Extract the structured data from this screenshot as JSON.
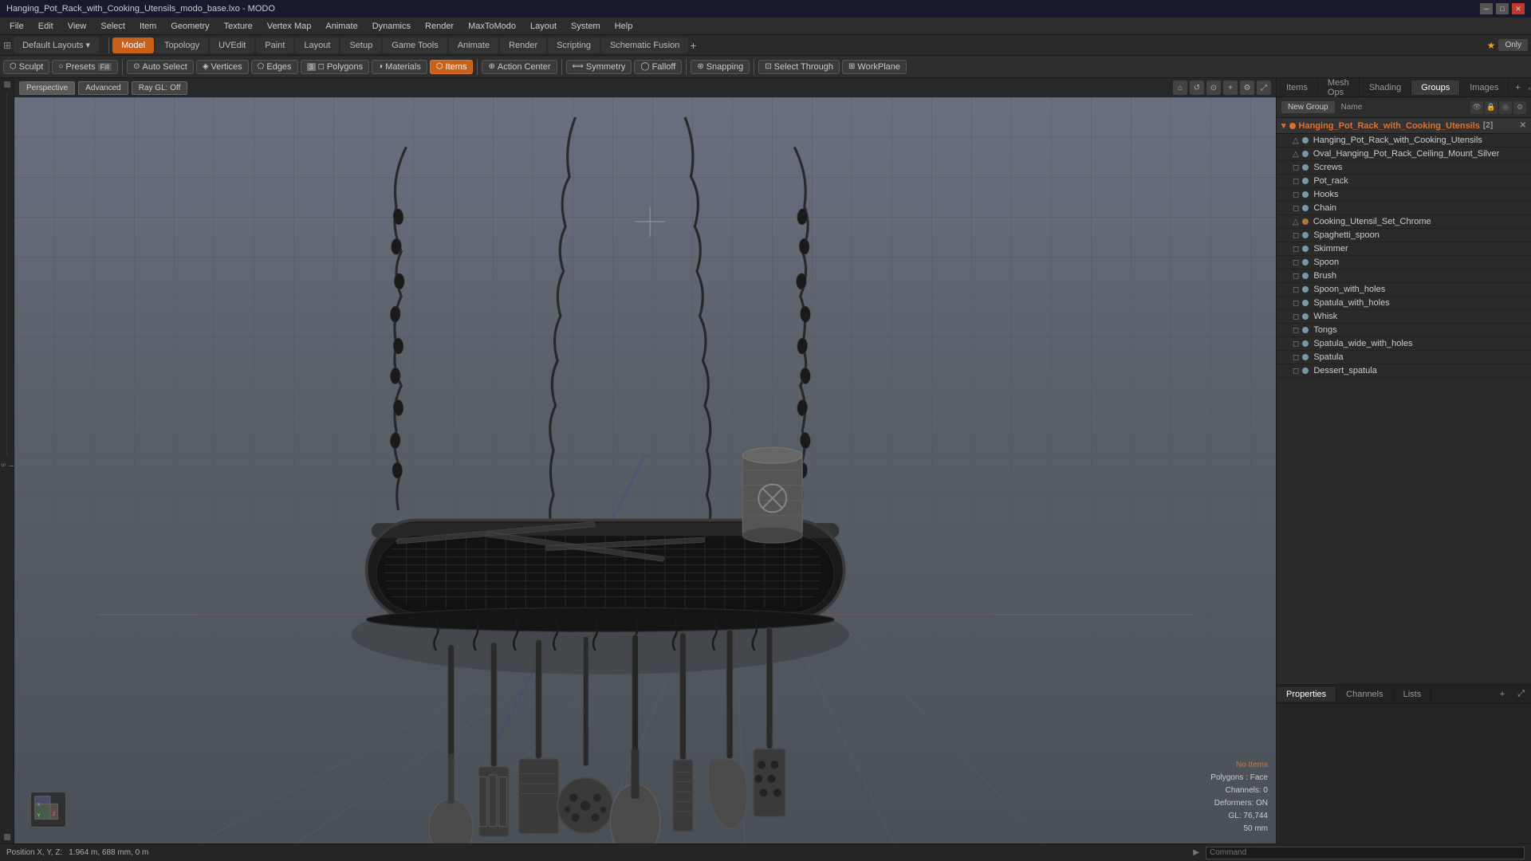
{
  "window": {
    "title": "Hanging_Pot_Rack_with_Cooking_Utensils_modo_base.lxo - MODO"
  },
  "menu": {
    "items": [
      "File",
      "Edit",
      "View",
      "Select",
      "Item",
      "Geometry",
      "Texture",
      "Vertex Map",
      "Animate",
      "Dynamics",
      "Render",
      "MaxToModo",
      "Layout",
      "System",
      "Help"
    ]
  },
  "toolbar_row1": {
    "tabs": [
      "Model",
      "Topology",
      "UVEdit",
      "Paint",
      "Layout",
      "Setup",
      "Game Tools",
      "Animate",
      "Render",
      "Scripting",
      "Schematic Fusion"
    ],
    "active_tab": "Model",
    "star_label": "★",
    "only_label": "Only",
    "plus_label": "+"
  },
  "toolbar_row2": {
    "sculpt_label": "Sculpt",
    "presets_label": "Presets",
    "fill_label": "Fill",
    "auto_select_label": "Auto Select",
    "vertices_label": "Vertices",
    "edges_label": "Edges",
    "polygons_count": "3",
    "polygons_label": "Polygons",
    "materials_label": "Materials",
    "items_label": "Items",
    "action_center_label": "Action Center",
    "symmetry_label": "Symmetry",
    "falloff_label": "Falloff",
    "snapping_label": "Snapping",
    "select_through_label": "Select Through",
    "workplane_label": "WorkPlane"
  },
  "viewport": {
    "mode_label": "Perspective",
    "advanced_label": "Advanced",
    "render_label": "Ray GL: Off",
    "stats": {
      "no_items": "No Items",
      "polygons_label": "Polygons : Face",
      "channels": "Channels: 0",
      "deformers": "Deformers: ON",
      "gl": "GL: 76,744",
      "size": "50 mm"
    }
  },
  "right_panel": {
    "tabs": [
      "Items",
      "Mesh Ops",
      "Shading",
      "Groups",
      "Images"
    ],
    "active_tab": "Groups",
    "plus_label": "+"
  },
  "items_panel": {
    "new_group_label": "New Group",
    "name_col": "Name",
    "group_name": "Hanging_Pot_Rack_with_Cooking_Utensils",
    "group_count": "2",
    "items": [
      {
        "name": "Hanging_Pot_Rack_with_Cooking_Utensils",
        "indent": 1,
        "type": "mesh"
      },
      {
        "name": "Oval_Hanging_Pot_Rack_Ceiling_Mount_Silver",
        "indent": 1,
        "type": "mesh"
      },
      {
        "name": "Screws",
        "indent": 1,
        "type": "mesh"
      },
      {
        "name": "Pot_rack",
        "indent": 1,
        "type": "mesh"
      },
      {
        "name": "Hooks",
        "indent": 1,
        "type": "mesh"
      },
      {
        "name": "Chain",
        "indent": 1,
        "type": "mesh"
      },
      {
        "name": "Cooking_Utensil_Set_Chrome",
        "indent": 1,
        "type": "group"
      },
      {
        "name": "Spaghetti_spoon",
        "indent": 1,
        "type": "mesh"
      },
      {
        "name": "Skimmer",
        "indent": 1,
        "type": "mesh"
      },
      {
        "name": "Spoon",
        "indent": 1,
        "type": "mesh"
      },
      {
        "name": "Brush",
        "indent": 1,
        "type": "mesh"
      },
      {
        "name": "Spoon_with_holes",
        "indent": 1,
        "type": "mesh"
      },
      {
        "name": "Spatula_with_holes",
        "indent": 1,
        "type": "mesh"
      },
      {
        "name": "Whisk",
        "indent": 1,
        "type": "mesh"
      },
      {
        "name": "Tongs",
        "indent": 1,
        "type": "mesh"
      },
      {
        "name": "Spatula_wide_with_holes",
        "indent": 1,
        "type": "mesh"
      },
      {
        "name": "Spatula",
        "indent": 1,
        "type": "mesh"
      },
      {
        "name": "Dessert_spatula",
        "indent": 1,
        "type": "mesh"
      }
    ]
  },
  "properties_panel": {
    "tabs": [
      "Properties",
      "Channels",
      "Lists"
    ],
    "active_tab": "Properties",
    "plus_label": "+"
  },
  "status_bar": {
    "position_label": "Position X, Y, Z:",
    "position_value": "1.964 m, 688 mm, 0 m",
    "command_placeholder": "Command"
  }
}
